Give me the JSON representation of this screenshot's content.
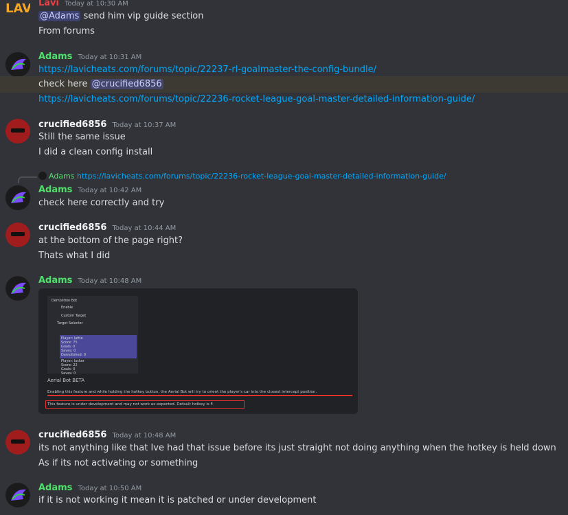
{
  "messages": [
    {
      "author": "Lavi",
      "timestamp": "Today at 10:30 AM",
      "lines": [
        [
          "@Adams",
          " send him vip guide section"
        ],
        [
          "From forums"
        ]
      ]
    },
    {
      "author": "Adams",
      "timestamp": "Today at 10:31 AM",
      "link1": "https://lavicheats.com/forums/topic/22237-rl-goalmaster-the-config-bundle/",
      "check_text": "check here ",
      "mention": "@crucified6856",
      "link2": "https://lavicheats.com/forums/topic/22236-rocket-league-goal-master-detailed-information-guide/"
    },
    {
      "author": "crucified6856",
      "timestamp": "Today at 10:37 AM",
      "lines": [
        "Still the same issue",
        "I did a clean config install"
      ]
    },
    {
      "reply_author": "Adams",
      "reply_text": "https://lavicheats.com/forums/topic/22236-rocket-league-goal-master-detailed-information-guide/",
      "author": "Adams",
      "timestamp": "Today at 10:42 AM",
      "lines": [
        "check here correctly and try"
      ]
    },
    {
      "author": "crucified6856",
      "timestamp": "Today at 10:44 AM",
      "lines": [
        "at the bottom of the page right?",
        "Thats what I did"
      ]
    },
    {
      "author": "Adams",
      "timestamp": "Today at 10:48 AM"
    },
    {
      "author": "crucified6856",
      "timestamp": "Today at 10:48 AM",
      "lines": [
        "its not anything like that Ive had that issue before its just straight not doing anything when the hotkey is held down",
        "As if its not activating or something"
      ]
    },
    {
      "author": "Adams",
      "timestamp": "Today at 10:50 AM",
      "lines": [
        "if it is not working it mean it is patched or under development"
      ]
    }
  ],
  "embed": {
    "panel": [
      "Demolition Bot",
      "Enable",
      "Custom Target",
      "Target Selector",
      "Player: lattie",
      "Score: 75",
      "Goals: 0",
      "Saves: 0",
      "Demolished: 0",
      "Player: lucker",
      "Score: 22",
      "Goals: 0",
      "Saves: 0",
      "Demolished: 0"
    ],
    "title": "Aerial Bot BETA",
    "desc": "Enabling this feature and while holding the hotkey button, the Aerial Bot will try to orient the player's car into the closest intercept position.",
    "warn": "This feature is under development and may not work as expected. Default hotkey is F."
  },
  "colors": {
    "background": "#313338",
    "link": "#00a8fc",
    "adams": "#4ee26b",
    "lavi": "#f23f43",
    "mention_bg": "#5865f2"
  }
}
